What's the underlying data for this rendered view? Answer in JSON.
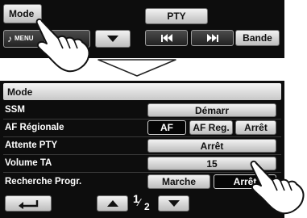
{
  "top": {
    "mode_label": "Mode",
    "pty_label": "PTY",
    "menu_label": "MENU",
    "bande_label": "Bande"
  },
  "menu": {
    "title": "Mode",
    "rows": [
      {
        "label": "SSM",
        "value": "Démarr"
      },
      {
        "label": "AF Régionale",
        "options": [
          "AF",
          "AF Reg.",
          "Arrêt"
        ],
        "selected": "AF"
      },
      {
        "label": "Attente PTY",
        "value": "Arrêt"
      },
      {
        "label": "Volume TA",
        "value": "15"
      },
      {
        "label": "Recherche Progr.",
        "options": [
          "Marche",
          "Arrêt"
        ],
        "selected": "Arrêt"
      }
    ],
    "page_current": "1",
    "page_total": "2"
  },
  "icons": {
    "music_note": "music-note-icon",
    "down_arrow": "chevron-down-icon",
    "skip_back": "skip-back-icon",
    "skip_forward": "skip-forward-icon",
    "back": "back-arrow-icon",
    "up_arrow": "chevron-up-icon",
    "hand": "pointing-hand-icon"
  },
  "colors": {
    "panel": "#0d0d0d",
    "button_light": "#e6e6e6",
    "button_selected": "#050505"
  }
}
